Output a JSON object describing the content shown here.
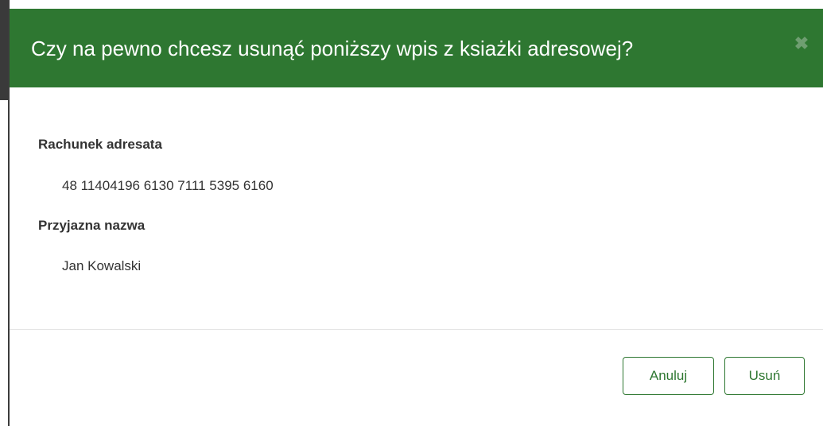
{
  "dialog": {
    "title": "Czy na pewno chcesz usunąć poniższy wpis z ksiażki adresowej?",
    "close_icon": "close-icon",
    "close_glyph": "✖"
  },
  "fields": {
    "account_label": "Rachunek adresata",
    "account_value": "48 11404196 6130 7111 5395 6160",
    "name_label": "Przyjazna nazwa",
    "name_value": "Jan Kowalski"
  },
  "footer": {
    "cancel_label": "Anuluj",
    "delete_label": "Usuń"
  },
  "colors": {
    "header_bg": "#2e7731",
    "button_accent": "#2e7731"
  }
}
